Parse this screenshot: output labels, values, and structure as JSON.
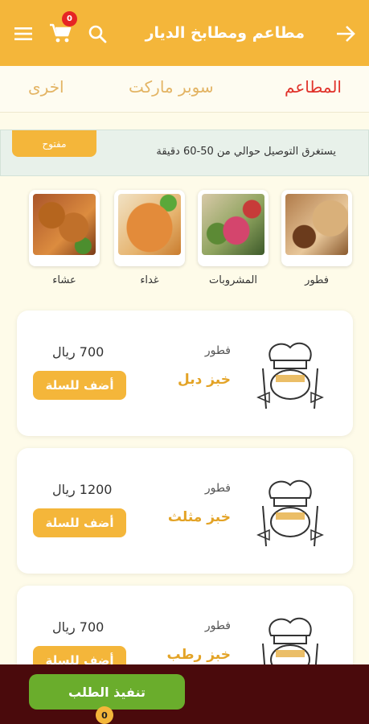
{
  "header": {
    "title": "مطاعم ومطابخ الديار",
    "cart_count": "0",
    "icons": [
      "menu-icon",
      "cart-icon",
      "search-icon",
      "arrow-right-icon"
    ]
  },
  "tabs": [
    {
      "label": "المطاعم",
      "active": true
    },
    {
      "label": "سوبر ماركت",
      "active": false
    },
    {
      "label": "اخرى",
      "active": false
    }
  ],
  "info": {
    "status": "مفتوح",
    "delivery": "يستغرق التوصيل حوالي من 50-60 دقيقة"
  },
  "categories": [
    {
      "label": "فطور"
    },
    {
      "label": "المشروبات"
    },
    {
      "label": "غداء"
    },
    {
      "label": "عشاء"
    }
  ],
  "products": [
    {
      "category": "فطور",
      "name": "خبز دبل",
      "price": "700 ريال",
      "add_label": "أضف للسلة"
    },
    {
      "category": "فطور",
      "name": "خبز مثلث",
      "price": "1200 ريال",
      "add_label": "أضف للسلة"
    },
    {
      "category": "فطور",
      "name": "خبز رطب",
      "price": "700 ريال",
      "add_label": "أضف للسلة"
    }
  ],
  "checkout": {
    "label": "تنفيذ الطلب",
    "count": "0"
  },
  "colors": {
    "primary": "#f4b63a",
    "active_tab": "#e0322a",
    "bottom_bar": "#4a0a0c",
    "checkout": "#6aad2c"
  }
}
